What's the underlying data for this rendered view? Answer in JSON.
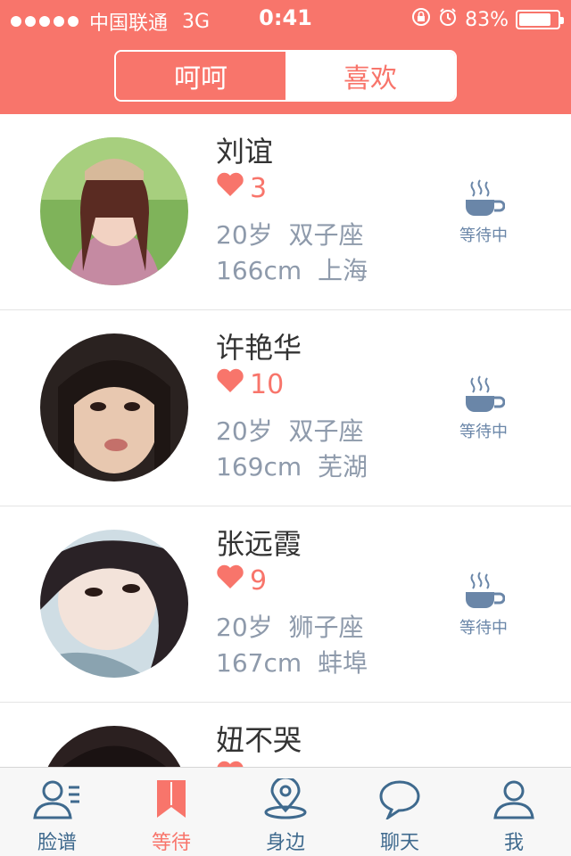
{
  "status_bar": {
    "carrier": "中国联通",
    "network": "3G",
    "time": "0:41",
    "battery": "83%",
    "battery_level": 0.83
  },
  "segment": {
    "tabs": [
      {
        "label": "呵呵",
        "active": true
      },
      {
        "label": "喜欢",
        "active": false
      }
    ]
  },
  "list": {
    "items": [
      {
        "name": "刘谊",
        "likes": "3",
        "age": "20岁",
        "sign": "双子座",
        "height": "166cm",
        "city": "上海",
        "status": "等待中"
      },
      {
        "name": "许艳华",
        "likes": "10",
        "age": "20岁",
        "sign": "双子座",
        "height": "169cm",
        "city": "芜湖",
        "status": "等待中"
      },
      {
        "name": "张远霞",
        "likes": "9",
        "age": "20岁",
        "sign": "狮子座",
        "height": "167cm",
        "city": "蚌埠",
        "status": "等待中"
      },
      {
        "name": "妞不哭",
        "likes": "",
        "age": "",
        "sign": "",
        "height": "",
        "city": "",
        "status": ""
      }
    ]
  },
  "tab_bar": {
    "tabs": [
      {
        "label": "脸谱",
        "icon": "contacts-icon",
        "active": false
      },
      {
        "label": "等待",
        "icon": "bookmark-icon",
        "active": true
      },
      {
        "label": "身边",
        "icon": "location-pin-icon",
        "active": false
      },
      {
        "label": "聊天",
        "icon": "chat-bubble-icon",
        "active": false
      },
      {
        "label": "我",
        "icon": "user-icon",
        "active": false
      }
    ]
  },
  "colors": {
    "accent": "#F8756B",
    "text_meta": "#8e9aab",
    "icon_blue": "#6a86a8"
  }
}
